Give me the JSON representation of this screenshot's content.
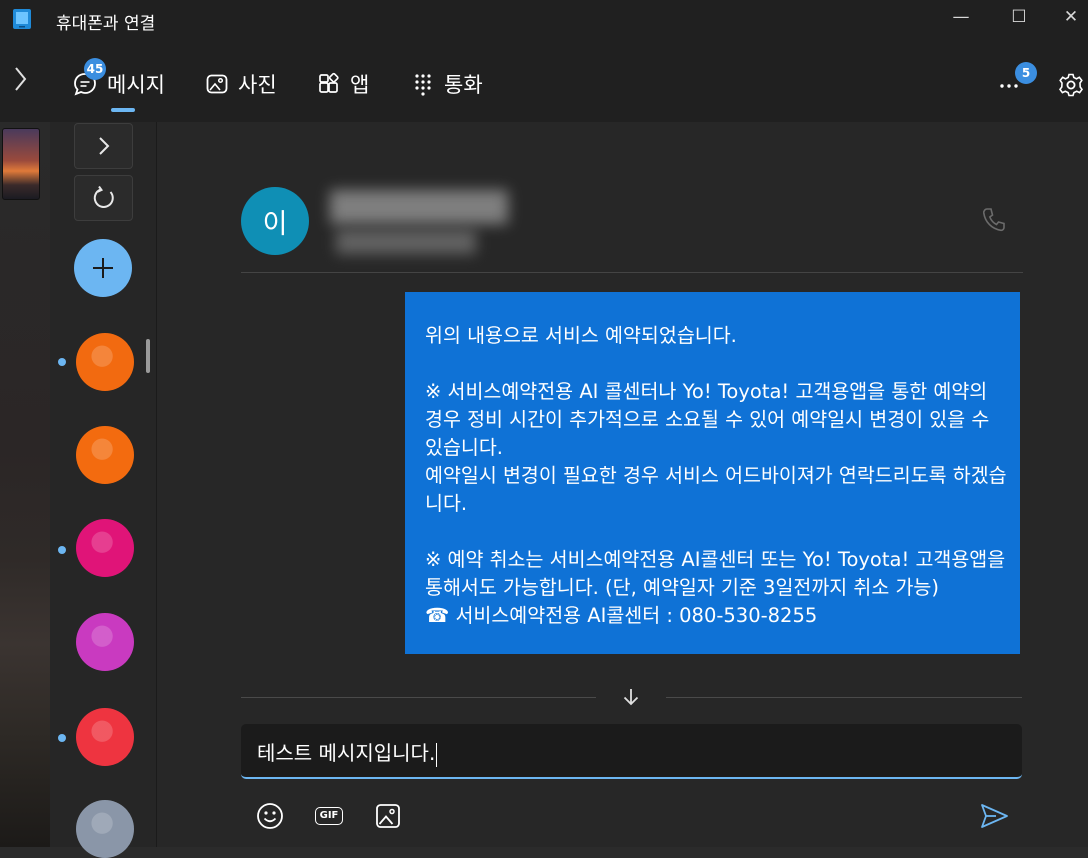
{
  "window": {
    "title": "휴대폰과 연결",
    "controls": {
      "minimize": "—",
      "maximize": "☐",
      "close": "✕"
    }
  },
  "nav": {
    "expand_icon": "chevron-right-icon",
    "tabs": [
      {
        "label": "메시지",
        "icon": "messages-icon",
        "badge": "45",
        "selected": true
      },
      {
        "label": "사진",
        "icon": "photos-icon"
      },
      {
        "label": "앱",
        "icon": "apps-icon"
      },
      {
        "label": "통화",
        "icon": "dialpad-icon"
      }
    ],
    "more_badge": "5",
    "more_icon": "more-icon",
    "settings_icon": "gear-icon"
  },
  "conversations": {
    "expand_icon": "chevron-right-icon",
    "refresh_icon": "refresh-icon",
    "new_icon": "plus-icon",
    "avatar_colors": [
      "#f26a10",
      "#f36b0f",
      "#e01478",
      "#c93ac0",
      "#ee3440",
      "#8a96a8"
    ]
  },
  "contact": {
    "initial": "이",
    "call_icon": "phone-icon",
    "avatar_color": "#0f8fb5"
  },
  "message": {
    "text": "위의 내용으로 서비스 예약되었습니다.\n\n※ 서비스예약전용 AI 콜센터나 Yo! Toyota! 고객용앱을 통한 예약의 경우 정비 시간이 추가적으로 소요될 수 있어 예약일시 변경이 있을 수 있습니다.\n예약일시 변경이 필요한 경우 서비스 어드바이져가 연락드리도록 하겠습니다.\n\n※ 예약 취소는 서비스예약전용 AI콜센터 또는 Yo! Toyota! 고객용앱을 통해서도 가능합니다. (단, 예약일자 기준 3일전까지 취소 가능)\n☎ 서비스예약전용 AI콜센터 : 080-530-8255",
    "bubble_color": "#0f72d6"
  },
  "compose": {
    "value": "테스트 메시지입니다.",
    "emoji_icon": "emoji-icon",
    "gif_label": "GIF",
    "image_icon": "image-icon",
    "send_icon": "send-icon",
    "scroll_down_icon": "arrow-down-icon"
  },
  "colors": {
    "accent": "#6cb6f2",
    "badge": "#3b8ee0",
    "titlebar": "#202020"
  }
}
